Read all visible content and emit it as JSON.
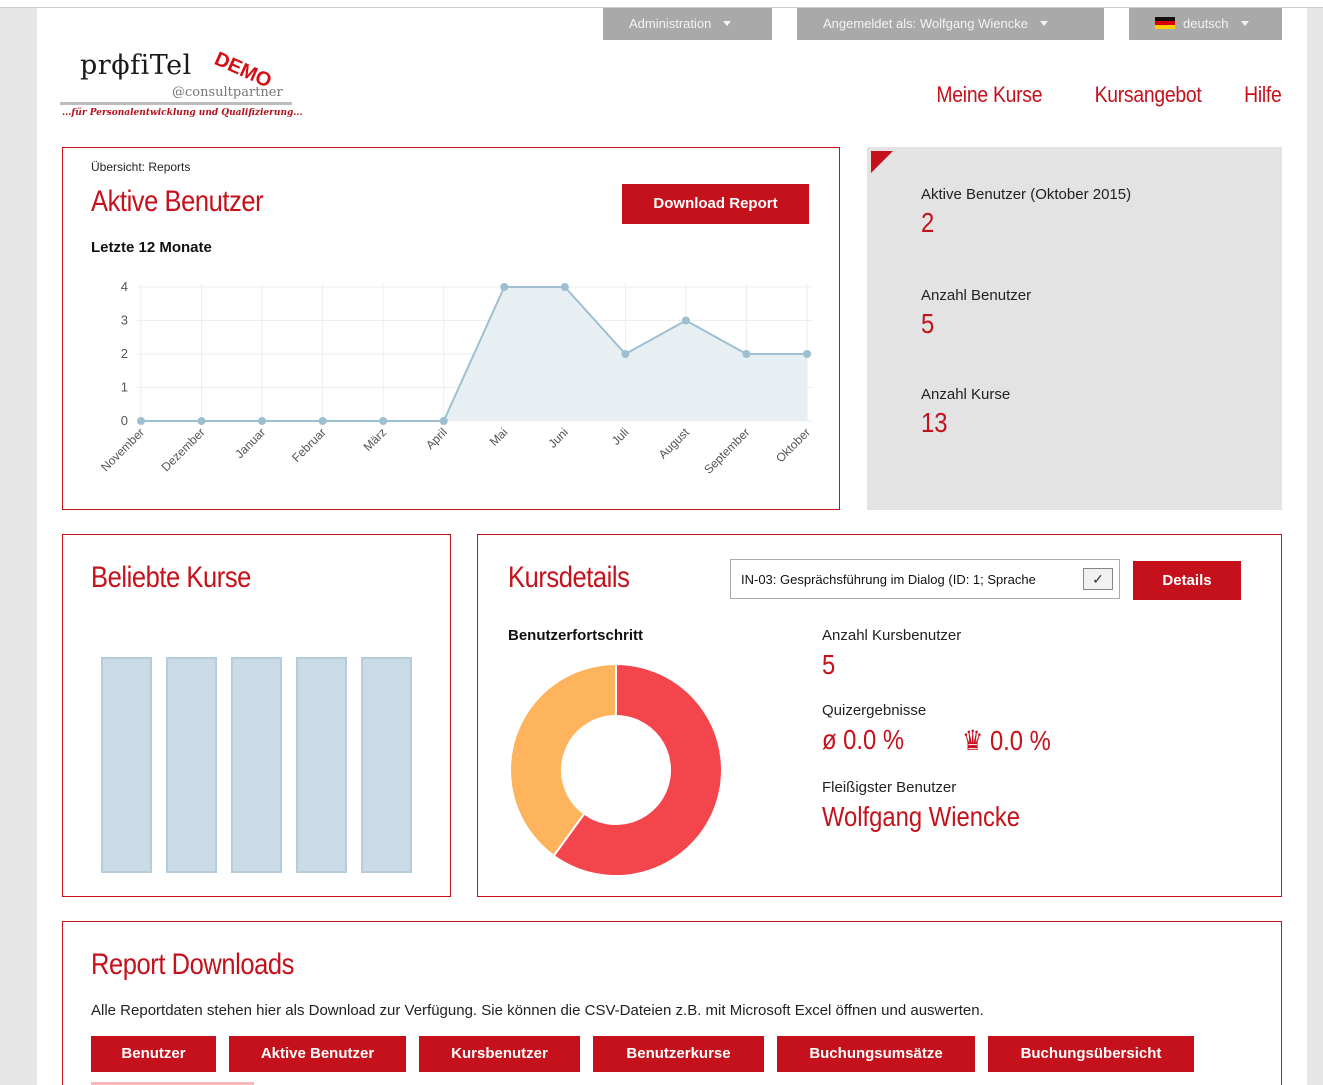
{
  "topbar": {
    "admin_label": "Administration",
    "user_label": "Angemeldet als: Wolfgang Wiencke",
    "language_label": "deutsch"
  },
  "logo": {
    "brand": "prϕfiTel",
    "badge": "DEMO",
    "sub": "@consultpartner",
    "tagline": "...für Personalentwicklung und Qualifizierung..."
  },
  "nav": {
    "items": [
      "Meine Kurse",
      "Kursangebot",
      "Hilfe"
    ]
  },
  "overview": {
    "breadcrumb": "Übersicht: Reports",
    "title": "Aktive Benutzer",
    "download_label": "Download Report",
    "subtitle": "Letzte 12 Monate"
  },
  "chart_data": {
    "type": "area",
    "title": "Letzte 12 Monate",
    "categories": [
      "November",
      "Dezember",
      "Januar",
      "Februar",
      "März",
      "April",
      "Mai",
      "Juni",
      "Juli",
      "August",
      "September",
      "Oktober"
    ],
    "values": [
      0,
      0,
      0,
      0,
      0,
      0,
      4,
      4,
      2,
      3,
      2,
      2
    ],
    "ylim": [
      0,
      4
    ],
    "yticks": [
      0,
      1,
      2,
      3,
      4
    ],
    "grid": true,
    "line_color": "#9ebfd1",
    "fill_color": "#e8eff3"
  },
  "stats": {
    "active_label": "Aktive Benutzer (Oktober 2015)",
    "active_value": "2",
    "users_label": "Anzahl Benutzer",
    "users_value": "5",
    "courses_label": "Anzahl Kurse",
    "courses_value": "13"
  },
  "popular": {
    "title": "Beliebte Kurse",
    "bars": [
      1,
      1,
      1,
      1,
      1
    ],
    "bar_color": "#c9dbe6"
  },
  "kursdetails": {
    "title": "Kursdetails",
    "select_value": "IN-03: Gesprächsführung im Dialog (ID: 1; Sprache",
    "details_label": "Details",
    "progress_label": "Benutzerfortschritt",
    "donut": [
      {
        "value": 60,
        "color": "#f4444c"
      },
      {
        "value": 40,
        "color": "#fdb45c"
      }
    ],
    "course_users_label": "Anzahl Kursbenutzer",
    "course_users_value": "5",
    "quiz_label": "Quizergebnisse",
    "quiz_avg": "ø 0.0 %",
    "quiz_best": "♛ 0.0 %",
    "top_user_label": "Fleißigster Benutzer",
    "top_user_value": "Wolfgang Wiencke"
  },
  "downloads": {
    "title": "Report Downloads",
    "text": "Alle Reportdaten stehen hier als Download zur Verfügung. Sie können die CSV-Dateien z.B. mit Microsoft Excel öffnen und auswerten.",
    "buttons": [
      "Benutzer",
      "Aktive Benutzer",
      "Kursbenutzer",
      "Benutzerkurse",
      "Buchungsumsätze",
      "Buchungsübersicht"
    ]
  }
}
